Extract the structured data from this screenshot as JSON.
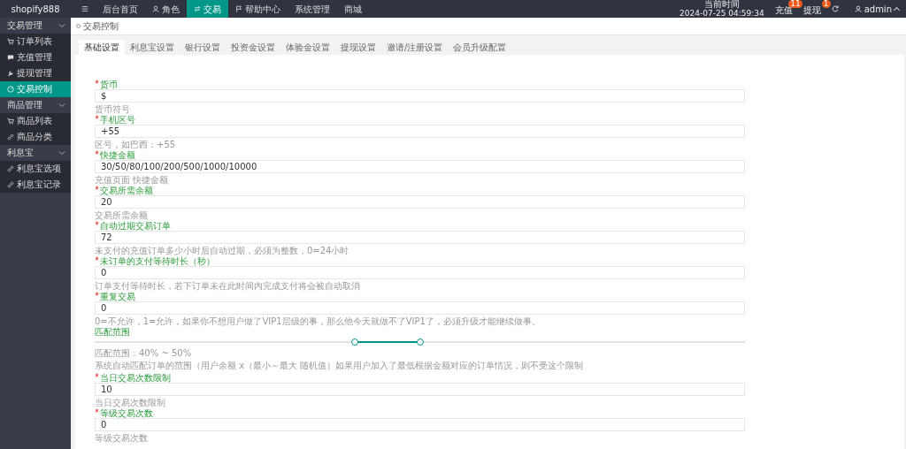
{
  "logo": "shopify888",
  "top_nav": [
    {
      "kind": "menu",
      "selected": false
    },
    {
      "kind": "text",
      "label": "后台首页",
      "selected": false
    },
    {
      "kind": "person",
      "label": "角色",
      "selected": false
    },
    {
      "kind": "swap",
      "label": "交易",
      "selected": true
    },
    {
      "kind": "flag",
      "label": "帮助中心",
      "selected": false
    },
    {
      "kind": "text",
      "label": "系统管理",
      "selected": false
    },
    {
      "kind": "text",
      "label": "商城",
      "selected": false
    }
  ],
  "clock": {
    "label": "当前时间",
    "time": "2024-07-25 04:59:34"
  },
  "top_actions": [
    {
      "label": "充值",
      "badge": "11"
    },
    {
      "label": "提现",
      "badge": "1"
    }
  ],
  "user": {
    "name": "admin"
  },
  "sidebar": {
    "groups": [
      {
        "label": "交易管理",
        "expanded": true,
        "children": [
          {
            "label": "订单列表",
            "kind": "cart",
            "selected": false
          },
          {
            "label": "充值管理",
            "kind": "chat",
            "selected": false
          },
          {
            "label": "提现管理",
            "kind": "wrench",
            "selected": false
          },
          {
            "label": "交易控制",
            "kind": "gauge",
            "selected": true
          }
        ]
      },
      {
        "label": "商品管理",
        "expanded": true,
        "children": [
          {
            "label": "商品列表",
            "kind": "cart",
            "selected": false
          },
          {
            "label": "商品分类",
            "kind": "link",
            "selected": false
          }
        ]
      },
      {
        "label": "利息宝",
        "expanded": true,
        "children": [
          {
            "label": "利息宝选项",
            "kind": "link",
            "selected": false
          },
          {
            "label": "利息宝记录",
            "kind": "link",
            "selected": false
          }
        ]
      }
    ]
  },
  "breadcrumb": "交易控制",
  "tabs": [
    {
      "label": "基础设置",
      "selected": true
    },
    {
      "label": "利息宝设置",
      "selected": false
    },
    {
      "label": "银行设置",
      "selected": false
    },
    {
      "label": "投资金设置",
      "selected": false
    },
    {
      "label": "体验金设置",
      "selected": false
    },
    {
      "label": "提现设置",
      "selected": false
    },
    {
      "label": "邀请/注册设置",
      "selected": false
    },
    {
      "label": "会员升级配置",
      "selected": false
    }
  ],
  "form": [
    {
      "kind": "input",
      "label": "货币",
      "required": true,
      "value": "$",
      "hint": "货币符号"
    },
    {
      "kind": "input",
      "label": "手机区号",
      "required": true,
      "value": "+55",
      "hint": "区号，如巴西：+55"
    },
    {
      "kind": "input",
      "label": "快捷金额",
      "required": true,
      "value": "30/50/80/100/200/500/1000/10000",
      "hint": "充值页面 快捷金额"
    },
    {
      "kind": "input",
      "label": "交易所需余额",
      "required": true,
      "value": "20",
      "hint": "交易所需余额"
    },
    {
      "kind": "input",
      "label": "自动过期交易订单",
      "required": true,
      "value": "72",
      "hint": "未支付的充值订单多少小时后自动过期，必须为整数，0=24小时"
    },
    {
      "kind": "input",
      "label": "未订单的支付等待时长（秒）",
      "required": true,
      "value": "0",
      "hint": "订单支付等待时长，若下订单未在此时间内完成支付将会被自动取消"
    },
    {
      "kind": "input",
      "label": "重复交易",
      "required": true,
      "value": "0",
      "hint": "0=不允许，1=允许，如果你不想用户做了VIP1层级的事，那么他今天就做不了VIP1了，必须升级才能继续做事。"
    },
    {
      "kind": "slider",
      "label": "匹配范围",
      "thumbs": [
        {
          "level": 0.4
        },
        {
          "level": 0.5
        }
      ],
      "reading": "匹配范围：40% ~ 50%",
      "hint": "系统自动匹配订单的范围（用户余额 x（最小～最大 随机值）如果用户加入了最低根据金额对应的订单情况，则不受这个限制"
    },
    {
      "kind": "input",
      "label": "当日交易次数限制",
      "required": true,
      "value": "10",
      "hint": "当日交易次数限制"
    },
    {
      "kind": "input",
      "label": "等级交易次数",
      "required": true,
      "value": "0",
      "hint": "等级交易次数"
    }
  ]
}
